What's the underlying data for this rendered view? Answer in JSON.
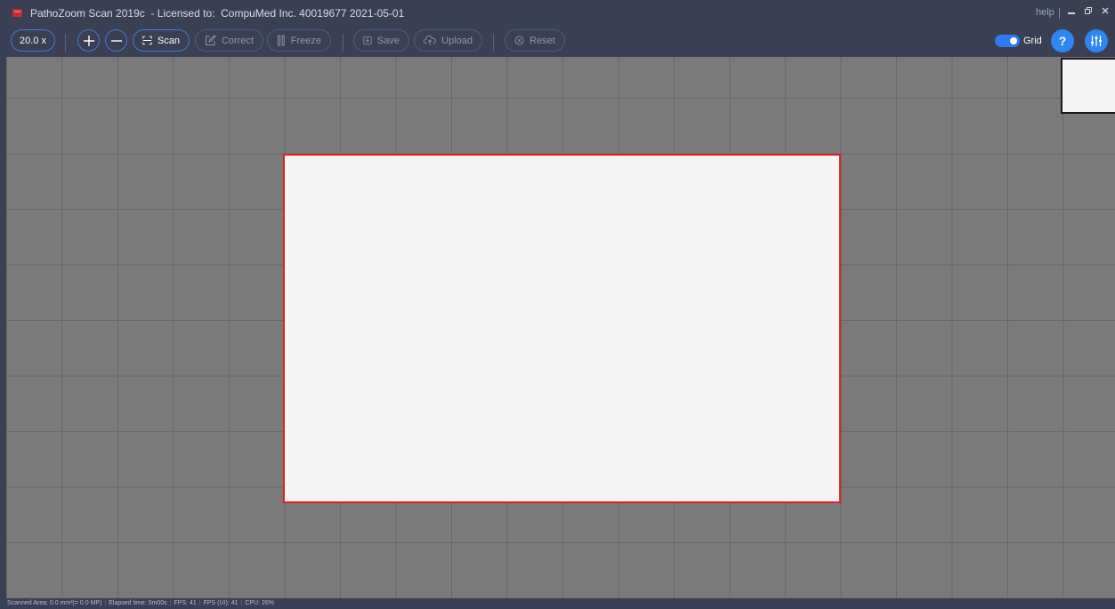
{
  "window": {
    "title": "PathoZoom Scan 2019c  - Licensed to:  CompuMed Inc. 40019677 2021-05-01",
    "help_link": "help",
    "minimize_icon": "minimize-icon",
    "restore_icon": "restore-icon",
    "close_icon": "close-icon",
    "app_icon": "app-logo-icon"
  },
  "toolbar": {
    "zoom_value": "20.0 x",
    "zoom_in_icon": "zoom-in-icon",
    "zoom_out_icon": "zoom-out-icon",
    "scan_label": "Scan",
    "correct_label": "Correct",
    "freeze_label": "Freeze",
    "save_label": "Save",
    "upload_label": "Upload",
    "reset_label": "Reset",
    "grid_label": "Grid",
    "grid_enabled": true,
    "help_glyph": "?",
    "settings_icon": "sliders-icon"
  },
  "colors": {
    "chrome": "#3a3f53",
    "accent": "#2f86ef",
    "scan_border": "#e0201e",
    "canvas": "#7a7a7a"
  },
  "status": {
    "scanned_area": "Scanned Area: 0.0 mm²(= 0.0 MP)",
    "elapsed": "Elapsed time: 0m00s",
    "fps": "FPS: 41",
    "fps_ui": "FPS (UI): 41",
    "cpu": "CPU: 26%"
  }
}
